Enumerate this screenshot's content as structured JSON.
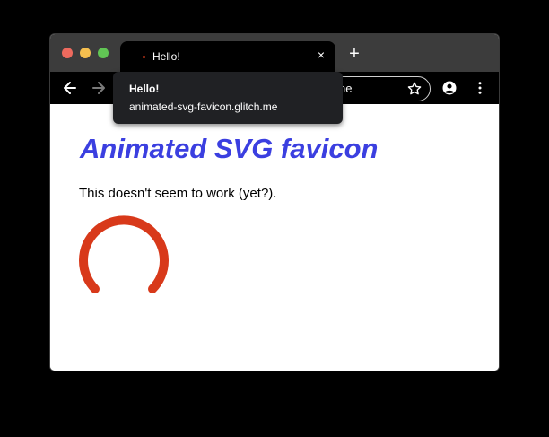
{
  "colors": {
    "heading": "#3b3fe0",
    "spinner": "#d8391a",
    "tab_bar": "#3c3c3c",
    "toolbar": "#000000",
    "tooltip_bg": "#202124"
  },
  "window": {
    "controls": [
      "close",
      "minimize",
      "maximize"
    ]
  },
  "tab": {
    "title": "Hello!",
    "close_label": "×",
    "favicon_icon": "animated-svg-favicon-icon"
  },
  "new_tab": {
    "label": "+"
  },
  "toolbar": {
    "back_icon": "arrow-left-icon",
    "forward_icon": "arrow-right-icon",
    "omnibox_text": "ne",
    "star_icon": "star-icon",
    "profile_icon": "account-circle-icon",
    "menu_icon": "more-vert-icon"
  },
  "tooltip": {
    "title": "Hello!",
    "url": "animated-svg-favicon.glitch.me"
  },
  "page": {
    "heading": "Animated SVG favicon",
    "paragraph": "This doesn't seem to work (yet?).",
    "spinner_icon": "progress-arc-icon"
  }
}
